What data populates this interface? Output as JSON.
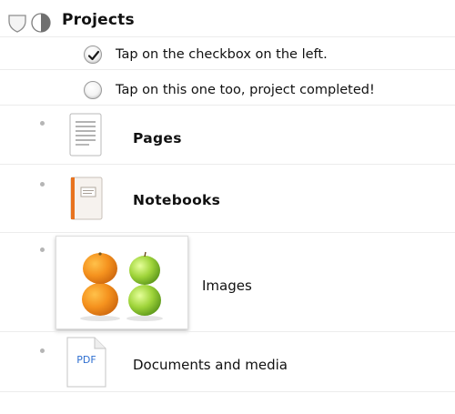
{
  "header": {
    "title": "Projects"
  },
  "tasks": [
    {
      "label": "Tap on the checkbox on the left.",
      "checked": true
    },
    {
      "label": "Tap on this one too, project completed!",
      "checked": false
    }
  ],
  "items": [
    {
      "label": "Pages",
      "icon": "pages-document-icon"
    },
    {
      "label": "Notebooks",
      "icon": "notebook-icon"
    },
    {
      "label": "Images",
      "icon": "image-thumbnail"
    },
    {
      "label": "Documents and media",
      "icon": "pdf-file-icon",
      "file_badge": "PDF"
    }
  ],
  "colors": {
    "accent_orange": "#e8731f",
    "pdf_blue": "#2f6fd0",
    "divider": "#ececec",
    "bullet": "#b5b5b5"
  }
}
